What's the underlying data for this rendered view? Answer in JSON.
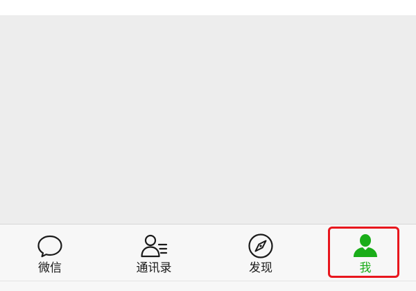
{
  "tab_bar": {
    "items": [
      {
        "key": "chats",
        "label": "微信",
        "icon": "chat-bubble-icon",
        "active": false
      },
      {
        "key": "contacts",
        "label": "通讯录",
        "icon": "contacts-icon",
        "active": false
      },
      {
        "key": "discover",
        "label": "发现",
        "icon": "compass-icon",
        "active": false
      },
      {
        "key": "me",
        "label": "我",
        "icon": "person-icon",
        "active": true
      }
    ]
  },
  "colors": {
    "active": "#1aad19",
    "inactive": "#1a1a1a",
    "highlight_outline": "#e8161d",
    "content_background": "#ededed",
    "tab_bar_background": "#f7f7f7"
  }
}
